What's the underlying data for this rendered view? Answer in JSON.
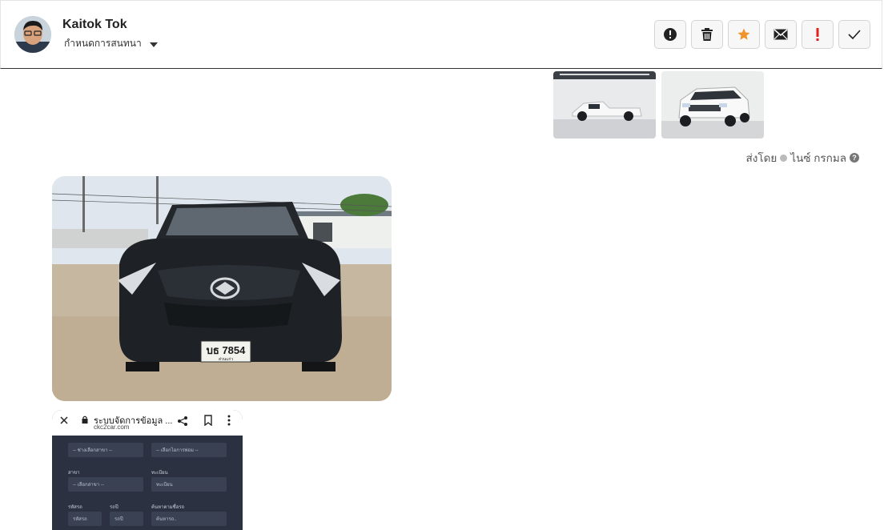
{
  "header": {
    "name": "Kaitok Tok",
    "subtitle": "กำหนดการสนทนา"
  },
  "actions": [
    {
      "icon": "alert-circle-icon",
      "color": "#222222"
    },
    {
      "icon": "trash-icon",
      "color": "#222222"
    },
    {
      "icon": "star-icon",
      "color": "#f0932b"
    },
    {
      "icon": "mail-icon",
      "color": "#222222"
    },
    {
      "icon": "exclamation-icon",
      "color": "#e0221b"
    },
    {
      "icon": "check-icon",
      "color": "#222222"
    }
  ],
  "message": {
    "sent_by_label": "ส่งโดย",
    "sender": "ไนซ์ กรกมล"
  },
  "phone_screenshot": {
    "title": "ระบบจัดการข้อมูล ...",
    "url": "ckc2car.com",
    "fields": [
      {
        "label": "",
        "value": "-- ช่างเลือกสาขา --"
      },
      {
        "label": "",
        "value": "-- เลือกไอการพ่อม --"
      },
      {
        "label": "สาขา",
        "value": "-- เลือกสาขา --"
      },
      {
        "label": "ทะเบียน",
        "value": "ทะเบียน"
      },
      {
        "label": "รหัสรถ",
        "value": "รหัสรถ"
      },
      {
        "label": "รถปี",
        "value": "รถปี"
      },
      {
        "label": "ค้นหาตามชื่อรถ",
        "value": "ค้นหารถ.."
      }
    ]
  },
  "plate": {
    "number": "บธ 7854",
    "province": "ส่วนแก่ว"
  }
}
